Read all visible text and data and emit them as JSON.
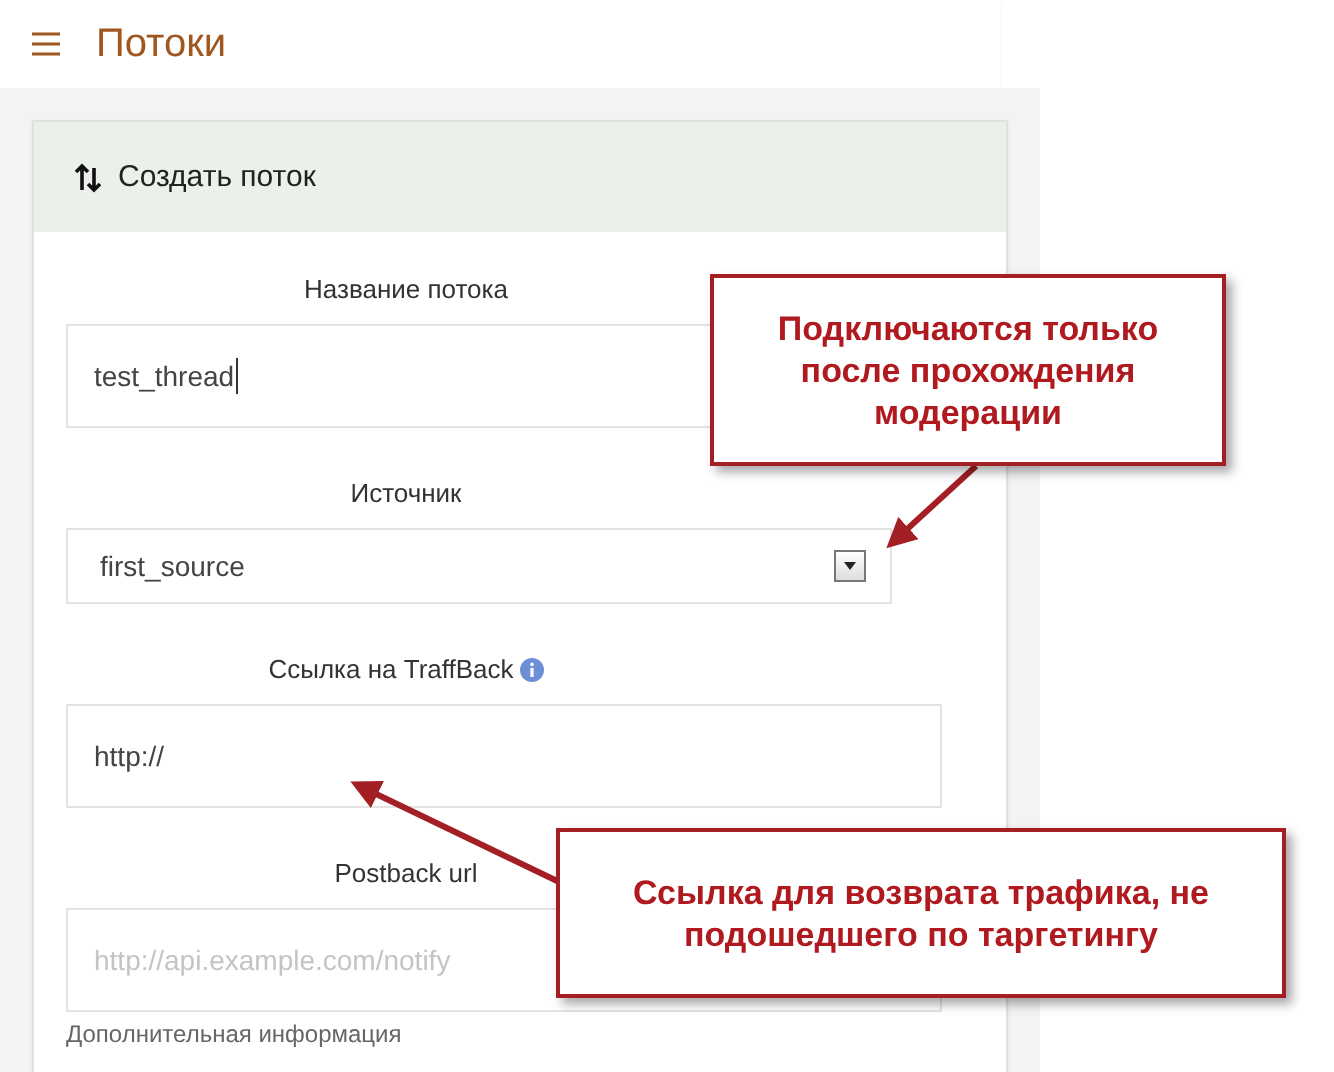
{
  "header": {
    "title": "Потоки"
  },
  "card": {
    "title": "Создать поток"
  },
  "fields": [
    {
      "kind": "text",
      "label": "Название потока",
      "value": "test_thread",
      "focused": true
    },
    {
      "kind": "select",
      "label": "Источник",
      "value": "first_source"
    },
    {
      "kind": "text",
      "label": "Ссылка на TraffBack",
      "info": true,
      "value": "http://"
    },
    {
      "kind": "text",
      "label": "Postback url",
      "placeholder": "http://api.example.com/notify",
      "help": "Дополнительная информация"
    }
  ],
  "callouts": [
    {
      "text": "Подключаются только после прохождения модерации"
    },
    {
      "text": "Ссылка для возврата трафика, не подошедшего по таргетингу"
    }
  ]
}
